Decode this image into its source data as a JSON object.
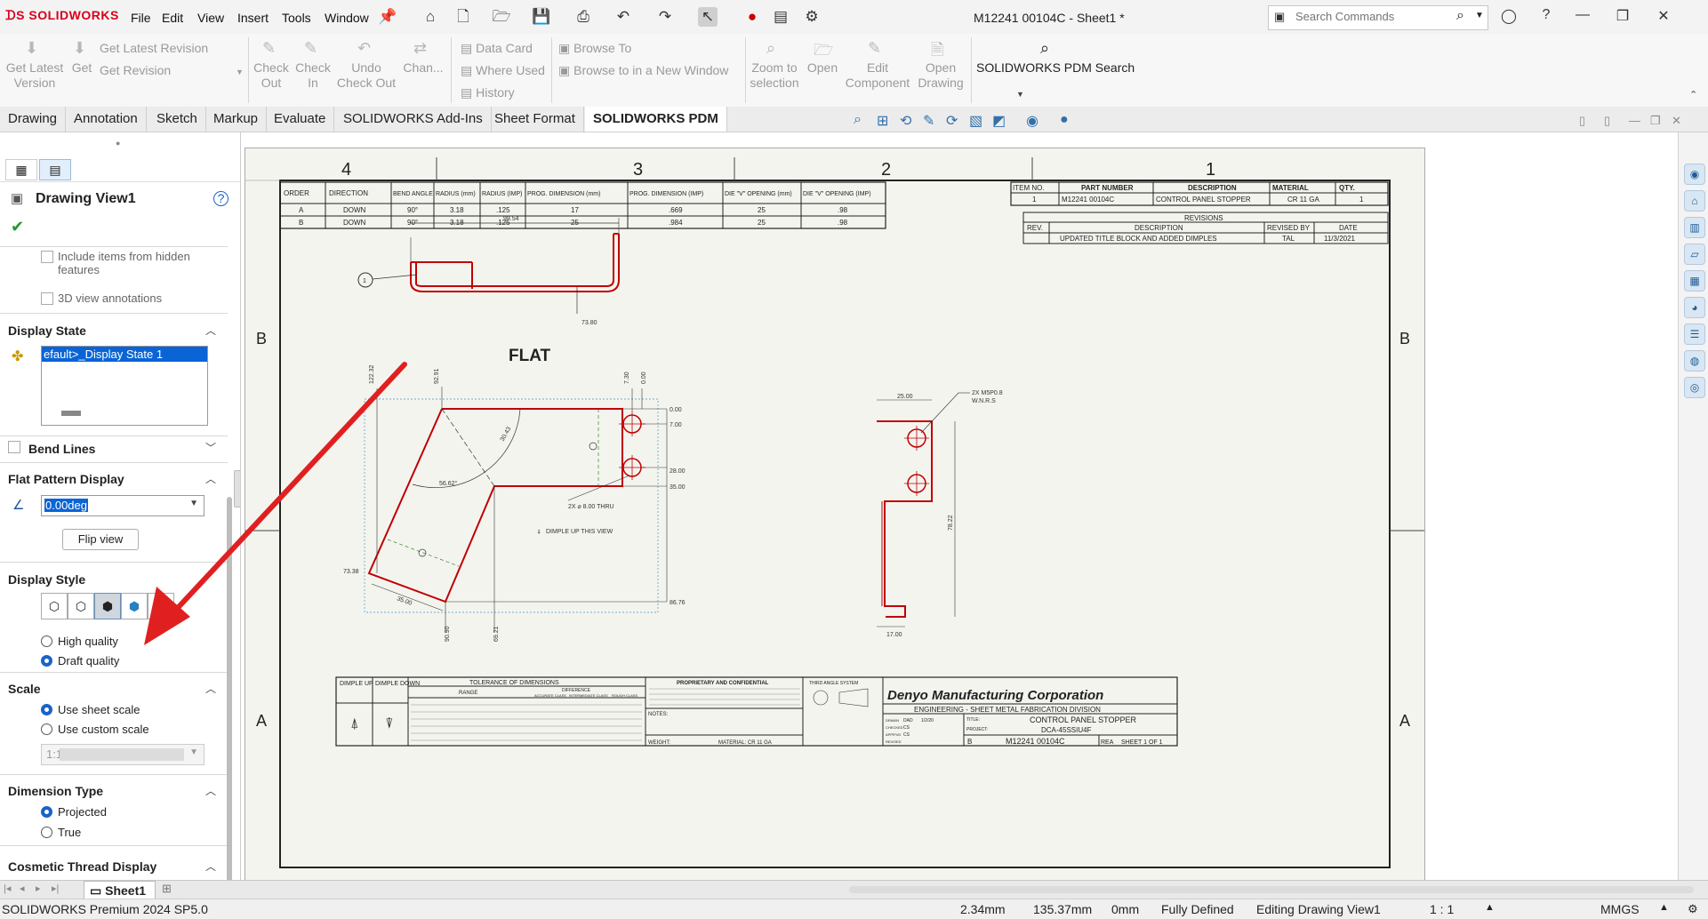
{
  "app": {
    "logo_text": "SOLIDWORKS",
    "document_title": "M12241 00104C - Sheet1 *"
  },
  "menu": [
    "File",
    "Edit",
    "View",
    "Insert",
    "Tools",
    "Window"
  ],
  "search": {
    "placeholder": "Search Commands"
  },
  "ribbon": {
    "get_latest_version": "Get Latest Version",
    "get": "Get",
    "get_latest_revision": "Get Latest Revision",
    "get_revision": "Get Revision",
    "check_out": "Check Out",
    "check_in": "Check In",
    "undo_check_out": "Undo Check Out",
    "change": "Chan...",
    "data_card": "Data Card",
    "where_used": "Where Used",
    "history": "History",
    "browse_to": "Browse To",
    "browse_new_window": "Browse to in a New Window",
    "zoom_to_selection": "Zoom to selection",
    "open": "Open",
    "edit_component": "Edit Component",
    "open_drawing": "Open Drawing",
    "pdm_search": "SOLIDWORKS PDM Search"
  },
  "tabs": [
    "Drawing",
    "Annotation",
    "Sketch",
    "Markup",
    "Evaluate",
    "SOLIDWORKS Add-Ins",
    "Sheet Format",
    "SOLIDWORKS PDM"
  ],
  "active_tab": "SOLIDWORKS PDM",
  "property_manager": {
    "title": "Drawing View1",
    "include_hidden": "Include items from hidden features",
    "view_3d_annotations": "3D view annotations",
    "display_state_header": "Display State",
    "display_state_item": "efault>_Display State 1",
    "bend_lines": "Bend Lines",
    "flat_pattern_header": "Flat Pattern Display",
    "flat_pattern_angle": "0.00deg",
    "flip_view": "Flip view",
    "display_style_header": "Display Style",
    "high_quality": "High quality",
    "draft_quality": "Draft quality",
    "scale_header": "Scale",
    "use_sheet_scale": "Use sheet scale",
    "use_custom_scale": "Use custom scale",
    "custom_scale_value": "1:1",
    "dimension_type_header": "Dimension Type",
    "projected": "Projected",
    "true": "True",
    "cosmetic_thread_header": "Cosmetic Thread Display"
  },
  "drawing": {
    "zones_top": [
      "4",
      "3",
      "2",
      "1"
    ],
    "zones_side": [
      "B",
      "A"
    ],
    "bend_table": {
      "headers": [
        "ORDER",
        "DIRECTION",
        "BEND ANGLE",
        "RADIUS (mm)",
        "RADIUS (IMP)",
        "PROG. DIMENSION (mm)",
        "PROG. DIMENSION (IMP)",
        "DIE \"V\" OPENING (mm)",
        "DIE \"V\" OPENING (IMP)"
      ],
      "rows": [
        [
          "A",
          "DOWN",
          "90°",
          "3.18",
          ".125",
          "17",
          ".669",
          "25",
          ".98"
        ],
        [
          "B",
          "DOWN",
          "90°",
          "3.18",
          ".125",
          "25",
          ".984",
          "25",
          ".98"
        ]
      ]
    },
    "bom": {
      "headers": [
        "ITEM NO.",
        "PART NUMBER",
        "DESCRIPTION",
        "MATERIAL",
        "QTY."
      ],
      "row": [
        "1",
        "M12241 00104C",
        "CONTROL PANEL STOPPER",
        "CR 11 GA",
        "1"
      ]
    },
    "revisions": {
      "title": "REVISIONS",
      "headers": [
        "REV.",
        "DESCRIPTION",
        "REVISED BY",
        "DATE"
      ],
      "row": [
        "",
        "UPDATED TITLE BLOCK AND ADDED DIMPLES",
        "TAL",
        "11/3/2021"
      ]
    },
    "flat_label": "FLAT",
    "balloon": "1",
    "dims": {
      "flat_width": "99.54",
      "flat_height": "73.80",
      "d122": "122.32",
      "d92": "92.91",
      "d730": "7.30",
      "d000v": "0.00",
      "d000": "0.00",
      "d700": "7.00",
      "d2800": "28.00",
      "d3500": "35.00",
      "d8676": "86.76",
      "d7338": "73.38",
      "d3500b": "35.00",
      "d9090": "90.90",
      "d6921": "69.21",
      "d5662": "56.62°",
      "d30": "30.43",
      "side_w": "25.00",
      "side_h": "78.22",
      "side_b": "17.00"
    },
    "hole_note": "2X ⌀ 8.00 THRU",
    "dimple_note": "DIMPLE UP THIS VIEW",
    "pem_note_1": "2X M5P0.8",
    "pem_note_2": "W.N.R.S",
    "title_block": {
      "dimple_up": "DIMPLE UP",
      "dimple_down": "DIMPLE DOWN",
      "tolerance_title": "TOLERANCE OF DIMENSIONS",
      "range": "RANGE",
      "difference": "DIFFERENCE",
      "accurate": "ACCURATE CLASS",
      "intermediate": "INTERMEDIATE CLASS",
      "rough": "ROUGH CLASS",
      "proprietary": "PROPRIETARY AND CONFIDENTIAL",
      "notes": "NOTES:",
      "weight": "WEIGHT:",
      "material": "MATERIAL: CR 11 GA",
      "third_angle": "THIRD ANGLE SYSTEM",
      "company": "Denyo Manufacturing Corporation",
      "dept": "ENGINEERING - SHEET METAL FABRICATION DIVISION",
      "title_label": "TITLE:",
      "title_value": "CONTROL PANEL STOPPER",
      "project_label": "PROJECT:",
      "project_value": "DCA-45SSIU4F",
      "size": "B",
      "dwg_no": "M12241 00104C",
      "rev": "REA",
      "sheet": "SHEET 1 OF 1",
      "drawn": "DRAWN",
      "drawn_by": "DAD",
      "drawn_date": "1/2/20",
      "checked": "CHECKED",
      "checked_by": "CS",
      "approved": "APPR'VD",
      "approved_by": "CS",
      "revised": "REVISED"
    }
  },
  "sheet_tab": "Sheet1",
  "status": {
    "version": "SOLIDWORKS Premium 2024 SP5.0",
    "x": "2.34mm",
    "y": "135.37mm",
    "z": "0mm",
    "defined": "Fully Defined",
    "editing": "Editing Drawing View1",
    "scale": "1 : 1",
    "units": "MMGS"
  }
}
